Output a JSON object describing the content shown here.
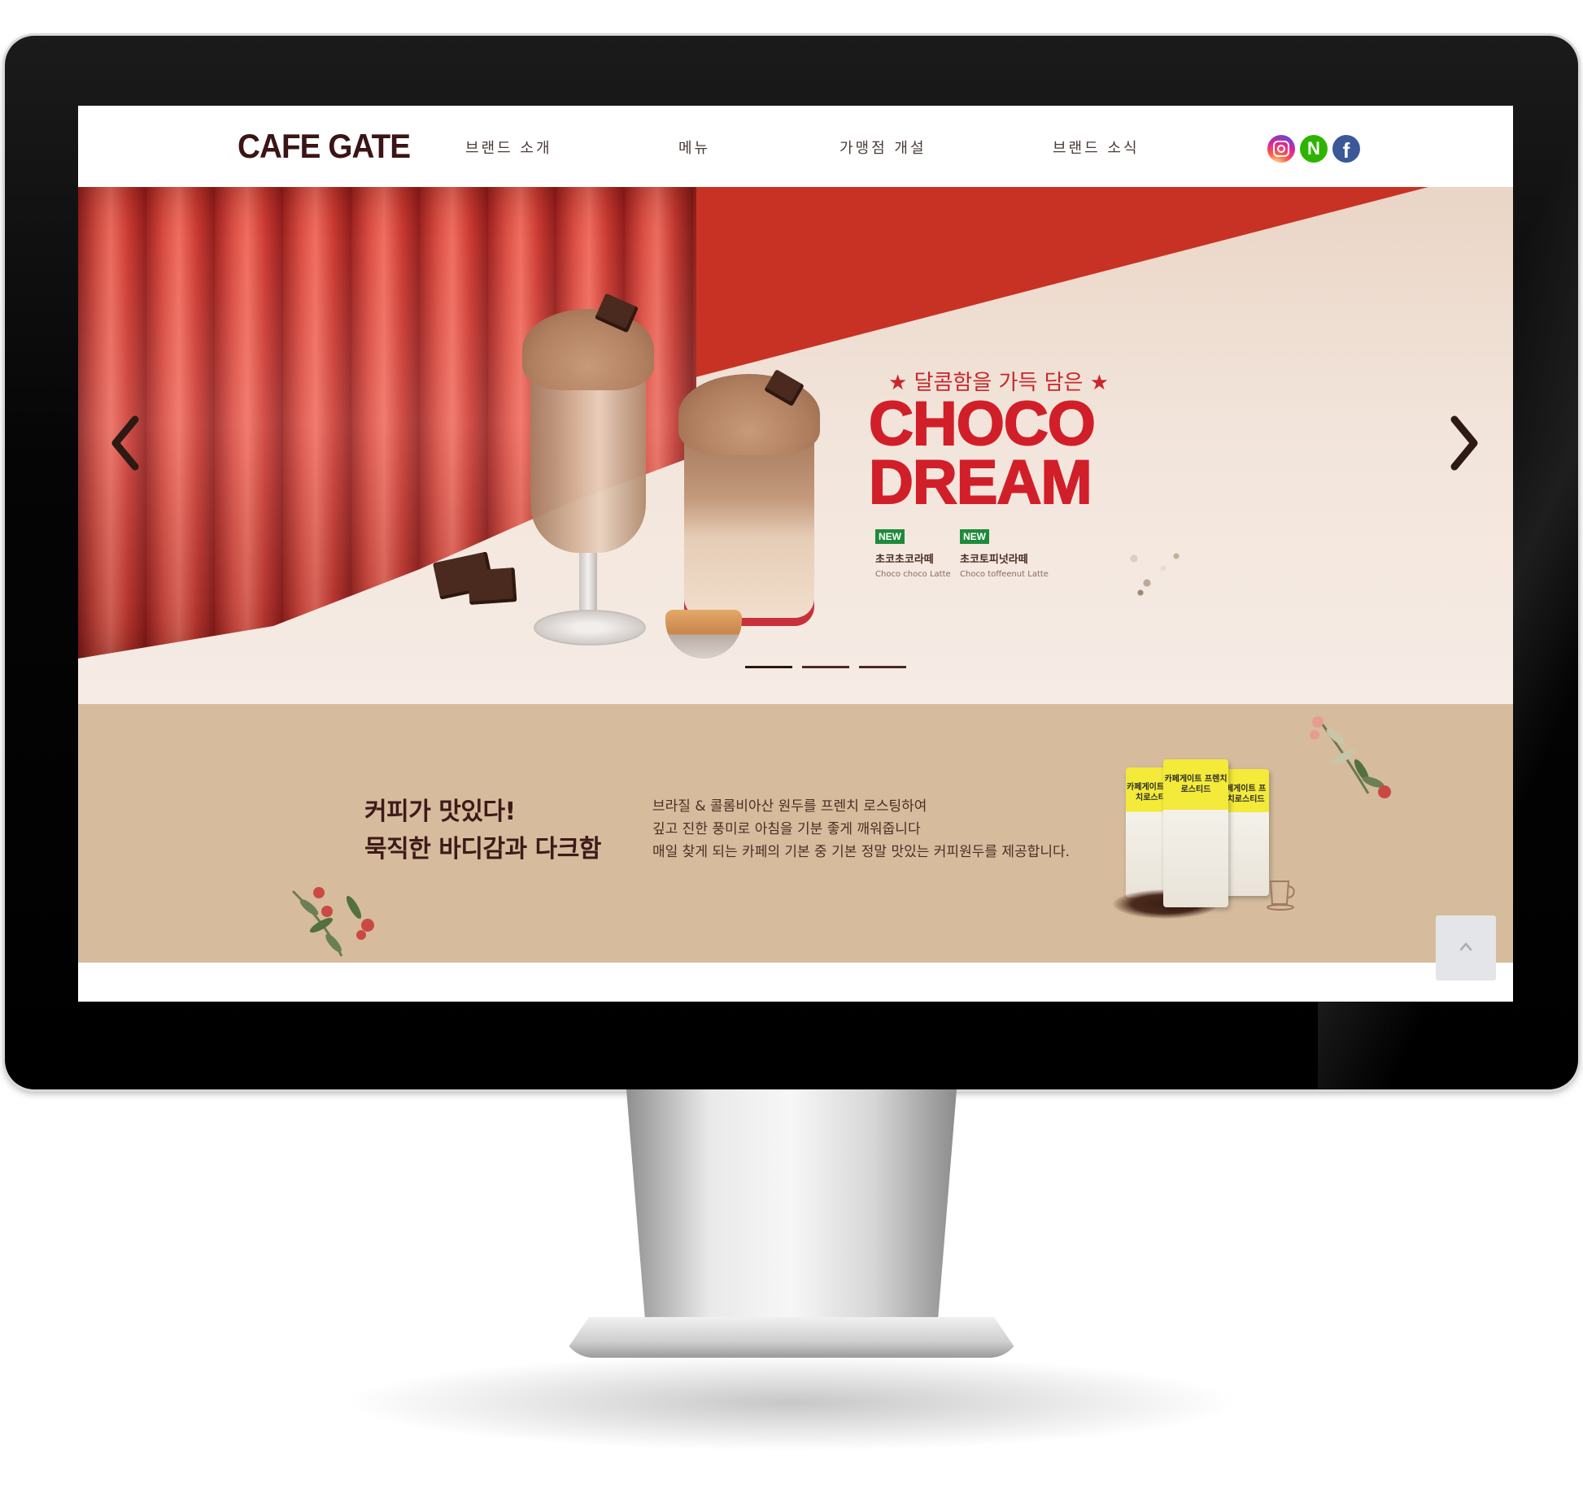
{
  "header": {
    "logo": "CAFE GATE",
    "nav": [
      "브랜드 소개",
      "메뉴",
      "가맹점 개설",
      "브랜드 소식"
    ],
    "social": [
      "instagram-icon",
      "naver-icon",
      "facebook-icon"
    ],
    "naver_glyph": "N",
    "facebook_glyph": "f"
  },
  "hero": {
    "eyebrow": "★ 달콤함을 가득 담은 ★",
    "title_line1": "CHOCO",
    "title_line2": "DREAM",
    "products": [
      {
        "badge": "NEW",
        "name_ko": "초코초코라떼",
        "name_en": "Choco choco Latte"
      },
      {
        "badge": "NEW",
        "name_ko": "초코토피넛라떼",
        "name_en": "Choco toffeenut Latte"
      }
    ],
    "slides_total": 3,
    "active_slide": 1
  },
  "coffee": {
    "headline_line1": "커피가 맛있다!",
    "headline_line2": "묵직한 바디감과 다크함",
    "body_lines": [
      "브라질 & 콜롬비아산 원두를 프렌치 로스팅하여",
      "깊고 진한 풍미로 아침을 기분 좋게 깨워줍니다",
      "매일 찾게 되는 카페의 기본 중 기본 정말 맛있는 커피원두를 제공합니다."
    ],
    "bag_label": "카페게이트 프렌치로스티드"
  },
  "colors": {
    "brand_dark": "#3b1414",
    "hero_red": "#d11f2a",
    "section_bg": "#d6bc9c",
    "new_badge": "#1e8a3a"
  }
}
